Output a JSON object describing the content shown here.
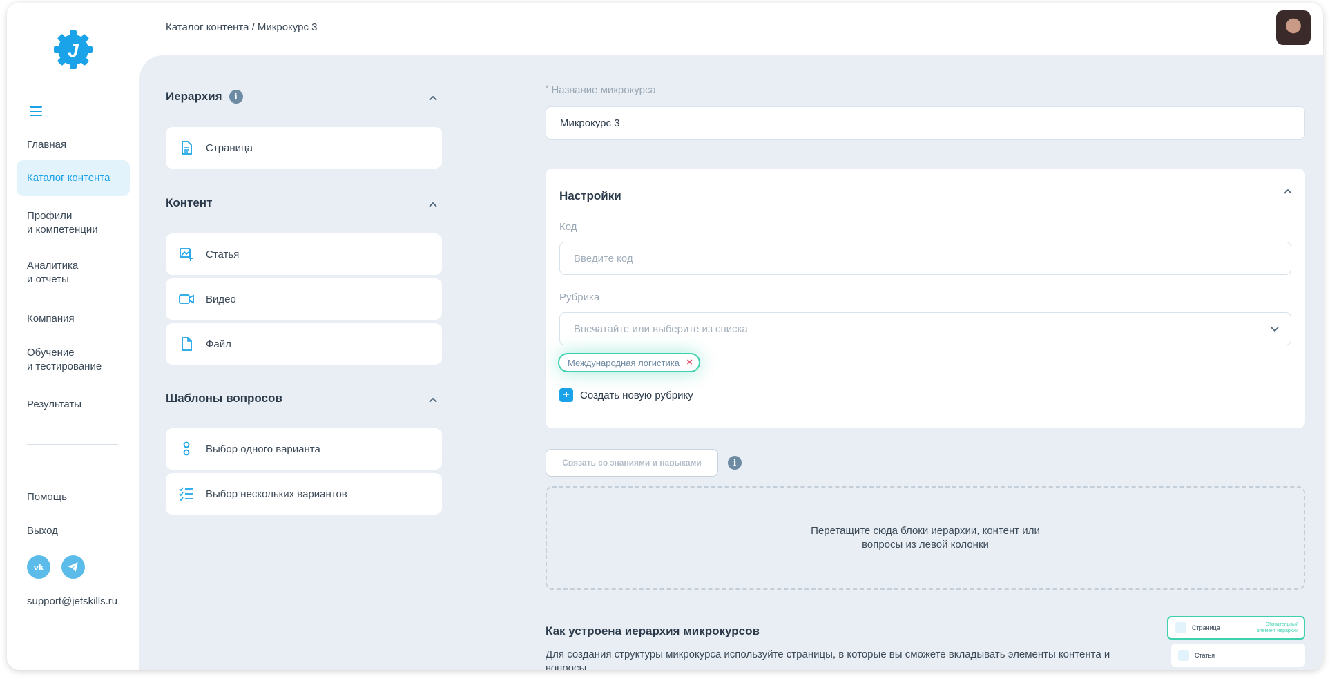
{
  "colors": {
    "accent": "#1aa3e8",
    "tag_border": "#3fd0b0",
    "main_bg": "#e9eef4",
    "remove": "#e35a6e"
  },
  "sidebar": {
    "items": [
      {
        "label": "Главная"
      },
      {
        "label": "Каталог контента",
        "active": true
      },
      {
        "label": "Профили\nи компетенции"
      },
      {
        "label": "Аналитика\nи отчеты"
      },
      {
        "label": "Компания"
      },
      {
        "label": "Обучение\nи тестирование"
      },
      {
        "label": "Результаты"
      }
    ],
    "bottom": [
      {
        "label": "Помощь"
      },
      {
        "label": "Выход"
      }
    ],
    "social": [
      {
        "icon": "vk-icon",
        "text": "vk"
      },
      {
        "icon": "telegram-icon",
        "text": ""
      }
    ],
    "support_email": "support@jetskills.ru"
  },
  "header": {
    "breadcrumb": "Каталог контента / Микрокурс 3"
  },
  "palette": {
    "hierarchy": {
      "title": "Иерархия",
      "items": [
        {
          "label": "Страница",
          "icon": "page-icon"
        }
      ]
    },
    "content": {
      "title": "Контент",
      "items": [
        {
          "label": "Статья",
          "icon": "article-icon"
        },
        {
          "label": "Видео",
          "icon": "video-icon"
        },
        {
          "label": "Файл",
          "icon": "file-icon"
        }
      ]
    },
    "questions": {
      "title": "Шаблоны вопросов",
      "items": [
        {
          "label": "Выбор одного варианта",
          "icon": "single-choice-icon"
        },
        {
          "label": "Выбор нескольких вариантов",
          "icon": "multiple-choice-icon"
        }
      ]
    }
  },
  "form": {
    "name_label": "Название микрокурса",
    "name_value": "Микрокурс 3",
    "settings_title": "Настройки",
    "code_label": "Код",
    "code_placeholder": "Введите код",
    "rubric_label": "Рубрика",
    "rubric_placeholder": "Впечатайте или выберите из списка",
    "tag": "Международная логистика",
    "create_rubric": "Создать новую рубрику",
    "link_button": "Связать со знаниями и навыками",
    "dropzone_line1": "Перетащите сюда блоки иерархии, контент или",
    "dropzone_line2": "вопросы из левой колонки"
  },
  "info": {
    "title": "Как устроена иерархия микрокурсов",
    "text": "Для создания структуры микрокурса используйте страницы, в которые вы сможете вкладывать элементы контента и вопросы."
  },
  "preview": {
    "page": "Страница",
    "page_note_1": "Обязательный",
    "page_note_2": "элемент иерархии",
    "article": "Статья"
  }
}
